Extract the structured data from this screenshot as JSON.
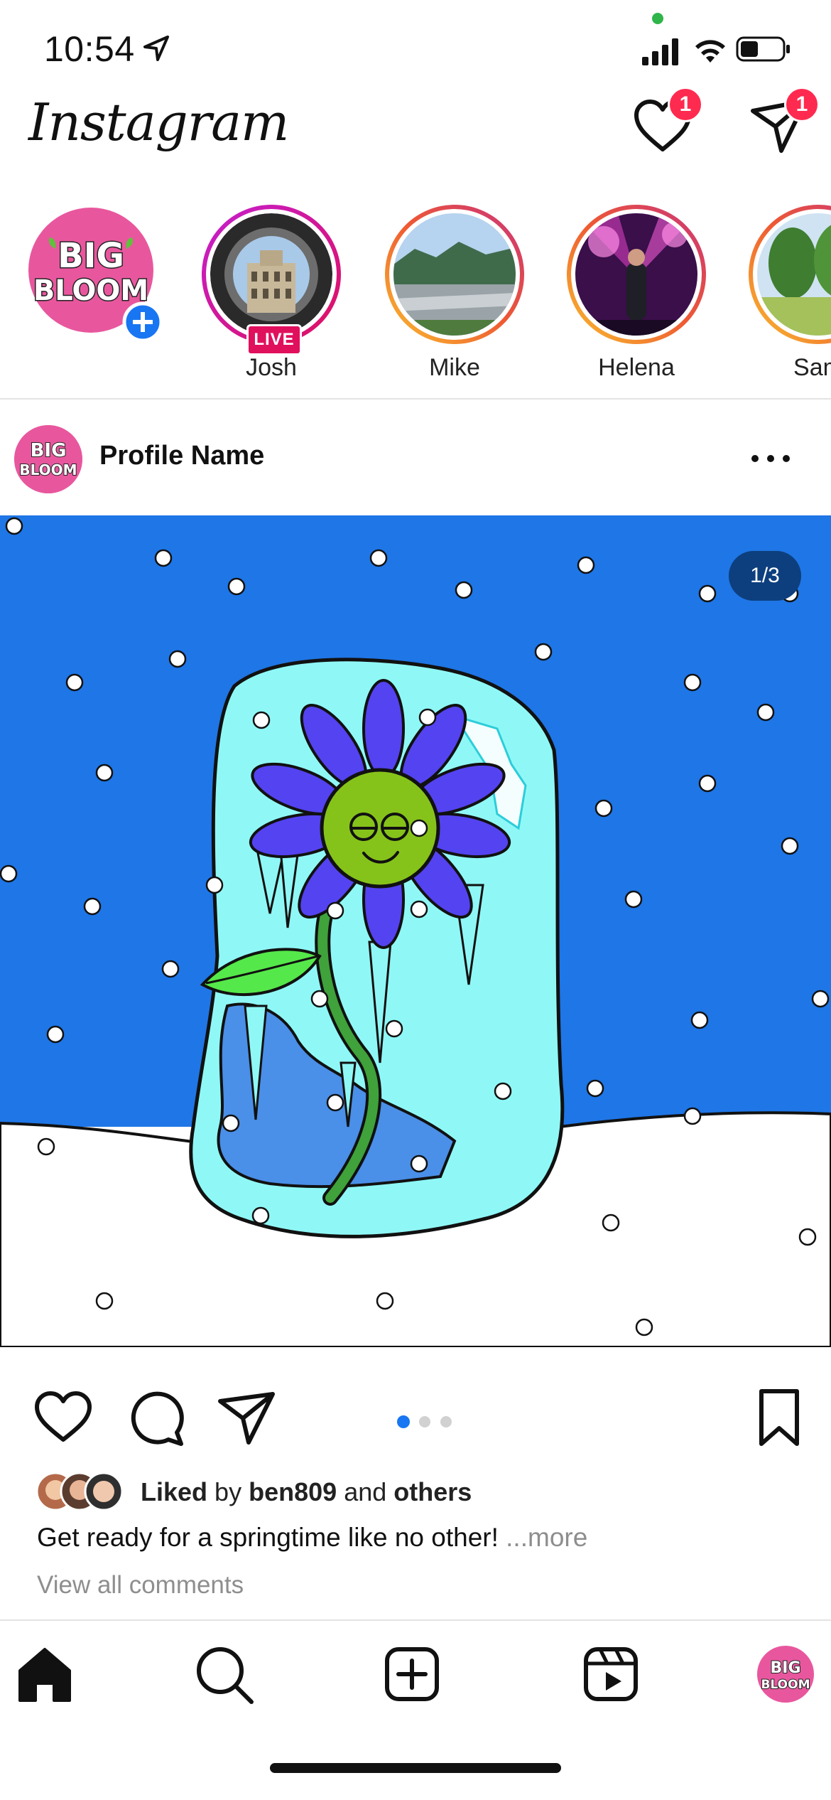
{
  "status_bar": {
    "time": "10:54"
  },
  "header": {
    "logo": "Instagram",
    "activity_badge": "1",
    "messages_badge": "1"
  },
  "stories": [
    {
      "name": "",
      "type": "own",
      "logo_text": "BIG BLOOM"
    },
    {
      "name": "Josh",
      "live_label": "LIVE",
      "ring": "live"
    },
    {
      "name": "Mike",
      "ring": "gradient"
    },
    {
      "name": "Helena",
      "ring": "gradient"
    },
    {
      "name": "Sam",
      "ring": "gradient"
    }
  ],
  "post": {
    "profile_name": "Profile Name",
    "page_indicator": "1/3",
    "liked_prefix": "Liked",
    "liked_by_word": "by",
    "liked_user": "ben809",
    "liked_and": "and",
    "liked_others": "others",
    "caption": "Get ready for a springtime like no other!",
    "caption_more": "...more",
    "view_comments": "View all comments"
  },
  "colors": {
    "sky": "#1f76e6",
    "ice": "#8ff8f6",
    "petal": "#5443f0",
    "flower_center": "#86c31a",
    "leaf": "#55e84a",
    "badge": "#ff2a4f",
    "live": "#e0105d",
    "bloom_pink": "#e8579e"
  }
}
